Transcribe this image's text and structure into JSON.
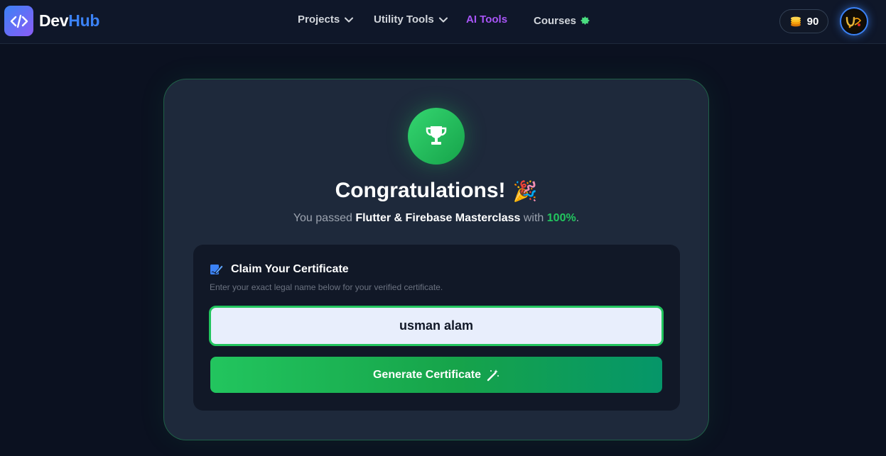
{
  "brand": {
    "logo_icon": "code-icon",
    "name_part1": "Dev",
    "name_part2": "Hub",
    "accent": "#3b82f6"
  },
  "nav": {
    "projects": "Projects",
    "utility_tools": "Utility Tools",
    "ai_tools": "AI Tools",
    "courses": "Courses"
  },
  "user": {
    "coins": "90",
    "coin_icon": "coins-icon"
  },
  "card": {
    "icon": "trophy-icon",
    "headline": "Congratulations!",
    "headline_emoji": "🎉",
    "sub_prefix": "You passed",
    "course_name": "Flutter & Firebase Masterclass",
    "sub_mid": "with",
    "score": "100%",
    "sub_suffix": ".",
    "claim_title": "Claim Your Certificate",
    "claim_desc": "Enter your exact legal name below for your verified certificate.",
    "name_value": "usman alam",
    "button_label": "Generate Certificate"
  },
  "colors": {
    "success": "#22c55e",
    "ai_tools": "#a855f7",
    "background": "#0b1120",
    "card": "#1e293b"
  }
}
